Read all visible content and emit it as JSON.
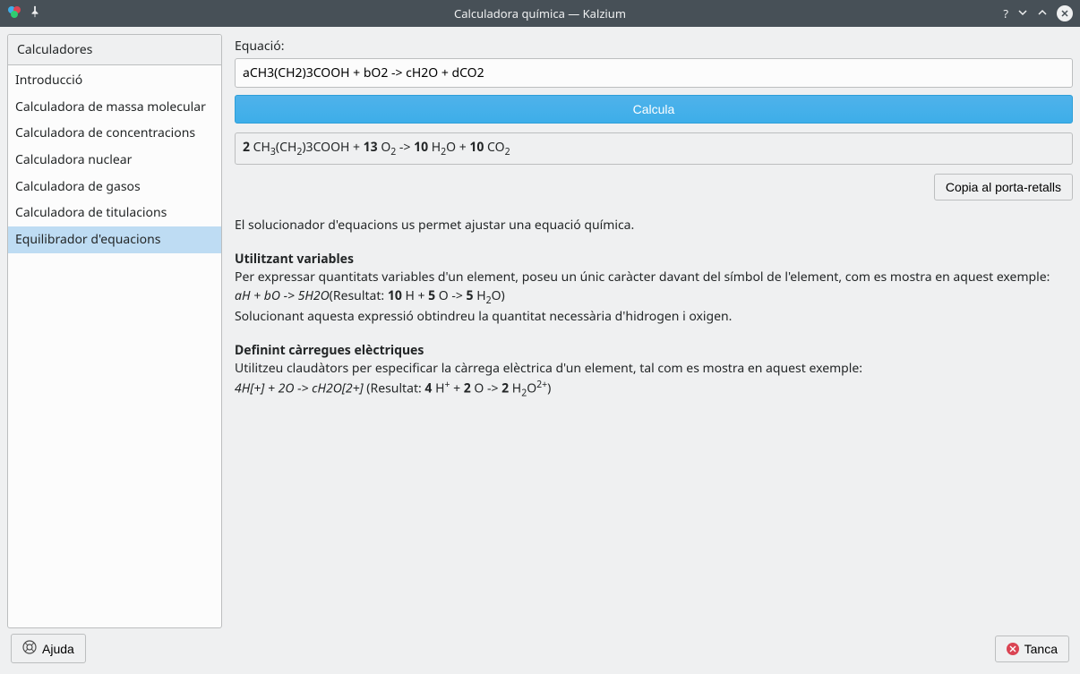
{
  "window": {
    "title": "Calculadora química — Kalzium"
  },
  "sidebar": {
    "header": "Calculadores",
    "items": [
      {
        "label": "Introducció"
      },
      {
        "label": "Calculadora de massa molecular"
      },
      {
        "label": "Calculadora de concentracions"
      },
      {
        "label": "Calculadora nuclear"
      },
      {
        "label": "Calculadora de gasos"
      },
      {
        "label": "Calculadora de titulacions"
      },
      {
        "label": "Equilibrador d'equacions"
      }
    ],
    "selected_index": 6
  },
  "main": {
    "equation_label": "Equació:",
    "equation_value": "aCH3(CH2)3COOH + bO2 -> cH2O + dCO2",
    "calculate_label": "Calcula",
    "result_html": "<b>2</b> CH<sub>3</sub>(CH<sub>2</sub>)3COOH + <b>13</b> O<sub>2</sub> -> <b>10</b> H<sub>2</sub>O + <b>10</b> CO<sub>2</sub>",
    "copy_label": "Copia al porta-retalls",
    "description": "El solucionador d'equacions us permet ajustar una equació química.",
    "section1_title": "Utilitzant variables",
    "section1_body": "Per expressar quantitats variables d'un element, poseu un únic caràcter davant del símbol de l'element, com es mostra en aquest exemple:",
    "section1_example_html": "<i>aH + bO -> 5H2O</i>(Resultat: <b>10</b> H + <b>5</b> O -> <b>5</b> H<sub>2</sub>O)",
    "section1_tail": "Solucionant aquesta expressió obtindreu la quantitat necessària d'hidrogen i oxigen.",
    "section2_title": "Definint càrregues elèctriques",
    "section2_body": "Utilitzeu claudàtors per especificar la càrrega elèctrica d'un element, tal com es mostra en aquest exemple:",
    "section2_example_html": "<i>4H[+] + 2O -> cH2O[2+]</i> (Resultat: <b>4</b> H<sup>+</sup> + <b>2</b> O -> <b>2</b> H<sub>2</sub>O<sup>2+</sup>)"
  },
  "footer": {
    "help_label": "Ajuda",
    "close_label": "Tanca"
  }
}
